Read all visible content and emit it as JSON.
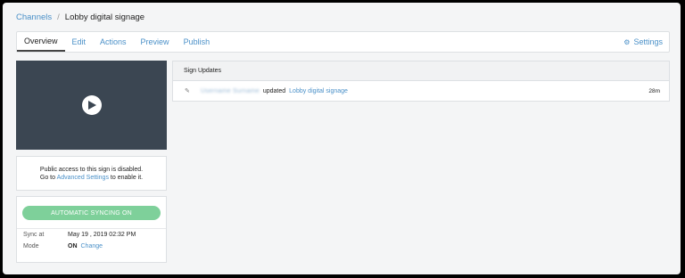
{
  "breadcrumb": {
    "root": "Channels",
    "separator": "/",
    "current": "Lobby digital signage"
  },
  "tabs": [
    {
      "label": "Overview",
      "active": true
    },
    {
      "label": "Edit"
    },
    {
      "label": "Actions"
    },
    {
      "label": "Preview"
    },
    {
      "label": "Publish"
    }
  ],
  "settings": {
    "label": "Settings",
    "icon": "gear-icon"
  },
  "preview": {
    "icon": "play-icon"
  },
  "access": {
    "line1": "Public access to this sign is disabled.",
    "line2_prefix": "Go to",
    "link": "Advanced Settings",
    "line2_suffix": "to enable it."
  },
  "sync": {
    "button": "AUTOMATIC SYNCING ON",
    "sync_at_label": "Sync at",
    "sync_at_value": "May 19 , 2019 02:32 PM",
    "mode_label": "Mode",
    "mode_value": "ON",
    "change_link": "Change"
  },
  "updates": {
    "header": "Sign Updates",
    "rows": [
      {
        "icon": "pencil-icon",
        "user": "Username Surname",
        "verb": "updated",
        "target": "Lobby digital signage",
        "time": "28m"
      }
    ]
  },
  "colors": {
    "accent": "#4a90c8",
    "sync_green": "#7ed09a",
    "preview_bg": "#3b4652"
  }
}
